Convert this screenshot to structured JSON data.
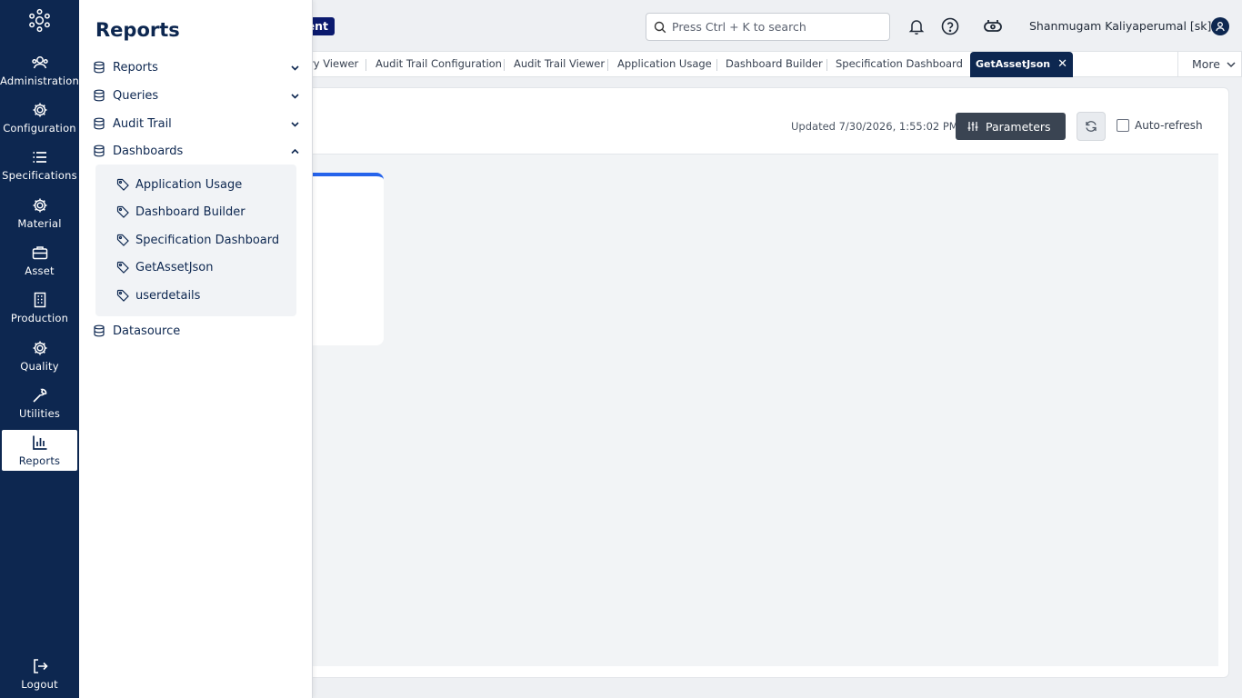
{
  "rail": {
    "items": [
      {
        "label": "Administration",
        "icon": "users-icon"
      },
      {
        "label": "Configuration",
        "icon": "gear-icon"
      },
      {
        "label": "Specifications",
        "icon": "list-icon"
      },
      {
        "label": "Material",
        "icon": "gear-icon"
      },
      {
        "label": "Asset",
        "icon": "briefcase-icon"
      },
      {
        "label": "Production",
        "icon": "building-icon"
      },
      {
        "label": "Quality",
        "icon": "gear-icon"
      },
      {
        "label": "Utilities",
        "icon": "wrench-icon"
      },
      {
        "label": "Reports",
        "icon": "bar-chart-icon"
      }
    ],
    "logout": "Logout"
  },
  "topbar": {
    "badge_text": "ent",
    "search_placeholder": "Press Ctrl + K to search",
    "user_name": "Shanmugam Kaliyaperumal [sk]"
  },
  "tabs": {
    "items": [
      "ry Viewer",
      "Audit Trail Configuration",
      "Audit Trail Viewer",
      "Application Usage",
      "Dashboard Builder",
      "Specification Dashboard"
    ],
    "active": "GetAssetJson",
    "more": "More"
  },
  "content": {
    "updated": "Updated 7/30/2026, 1:55:02 PM",
    "parameters_label": "Parameters",
    "auto_refresh_label": "Auto-refresh"
  },
  "flyout": {
    "title": "Reports",
    "sections": [
      "Reports",
      "Queries",
      "Audit Trail",
      "Dashboards"
    ],
    "dashboard_items": [
      "Application Usage",
      "Dashboard Builder",
      "Specification Dashboard",
      "GetAssetJson",
      "userdetails"
    ],
    "datasource": "Datasource"
  },
  "colors": {
    "rail_bg": "#0d2750",
    "accent_blue": "#2563eb",
    "badge_bg": "#0b1a6e",
    "parameters_bg": "#3a4452"
  }
}
